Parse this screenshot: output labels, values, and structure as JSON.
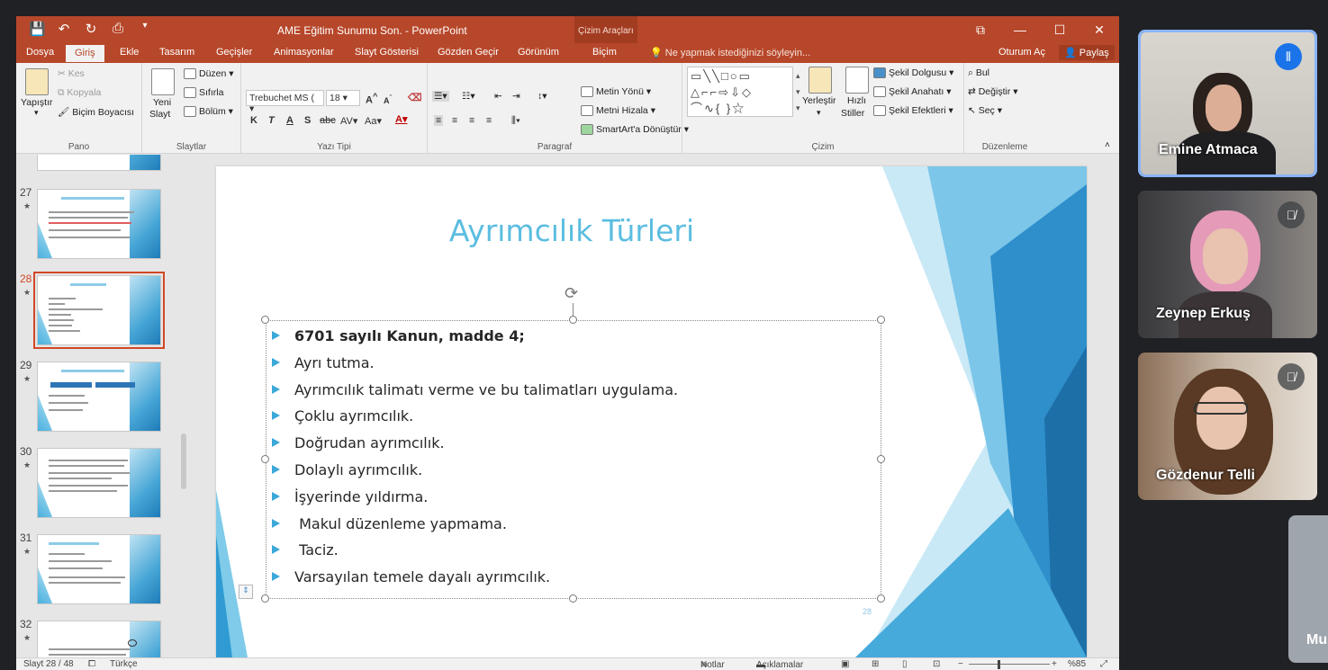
{
  "window": {
    "title": "AME Eğitim Sunumu Son. - PowerPoint",
    "contextual_group": "Çizim Araçları",
    "controls": [
      "⧉",
      "—",
      "☐",
      "✕"
    ]
  },
  "qat": [
    "💾",
    "↶",
    "↻",
    "⎙",
    "▾"
  ],
  "tabs": [
    "Dosya",
    "Giriş",
    "Ekle",
    "Tasarım",
    "Geçişler",
    "Animasyonlar",
    "Slayt Gösterisi",
    "Gözden Geçir",
    "Görünüm",
    "Biçim"
  ],
  "tellme": "Ne yapmak istediğinizi söyleyin...",
  "signin": "Oturum Aç",
  "share": "Paylaş",
  "ribbon": {
    "pano": {
      "label": "Pano",
      "paste": "Yapıştır",
      "cut": "Kes",
      "copy": "Kopyala",
      "format_painter": "Biçim Boyacısı"
    },
    "slaytlar": {
      "label": "Slaytlar",
      "new_slide_1": "Yeni",
      "new_slide_2": "Slayt",
      "layout": "Düzen",
      "reset": "Sıfırla",
      "section": "Bölüm"
    },
    "yazi_tipi": {
      "label": "Yazı Tipi",
      "font": "Trebuchet MS (",
      "size": "18"
    },
    "paragraf": {
      "label": "Paragraf",
      "text_direction": "Metin Yönü",
      "align_text": "Metni Hizala",
      "smartart": "SmartArt'a Dönüştür"
    },
    "cizim": {
      "label": "Çizim",
      "arrange": "Yerleştir",
      "quick_styles_1": "Hızlı",
      "quick_styles_2": "Stiller",
      "shape_fill": "Şekil Dolgusu",
      "shape_outline": "Şekil Anahatı",
      "shape_effects": "Şekil Efektleri"
    },
    "duzenleme": {
      "label": "Düzenleme",
      "find": "Bul",
      "replace": "Değiştir",
      "select": "Seç"
    }
  },
  "thumbnails": [
    {
      "number": "27"
    },
    {
      "number": "28",
      "selected": true
    },
    {
      "number": "29"
    },
    {
      "number": "30"
    },
    {
      "number": "31"
    },
    {
      "number": "32"
    }
  ],
  "slide": {
    "title": "Ayrımcılık Türleri",
    "bullets": [
      "6701 sayılı Kanun, madde 4;",
      "Ayrı tutma.",
      "Ayrımcılık talimatı verme ve bu talimatları uygulama.",
      "Çoklu ayrımcılık.",
      "Doğrudan ayrımcılık.",
      "Dolaylı ayrımcılık.",
      "İşyerinde yıldırma.",
      " Makul düzenleme yapmama.",
      " Taciz.",
      "Varsayılan temele dayalı ayrımcılık."
    ],
    "slide_number": "28"
  },
  "status": {
    "slide_counter": "Slayt 28 / 48",
    "language": "Türkçe",
    "notes": "Notlar",
    "comments": "Açıklamalar",
    "zoom": "%85"
  },
  "participants": [
    {
      "name": "Emine Atmaca",
      "speaking": true,
      "mic": "speaking-icon"
    },
    {
      "name": "Zeynep Erkuş",
      "speaking": false,
      "mic": "mic-off-icon"
    },
    {
      "name": "Gözdenur Telli",
      "speaking": false,
      "mic": "mic-off-icon"
    },
    {
      "name": "Mu"
    }
  ],
  "colors": {
    "ppt_accent": "#b7472a",
    "slide_title": "#5bbde0",
    "bullet": "#3ba8d8",
    "speaking_border": "#8ab4f8"
  }
}
